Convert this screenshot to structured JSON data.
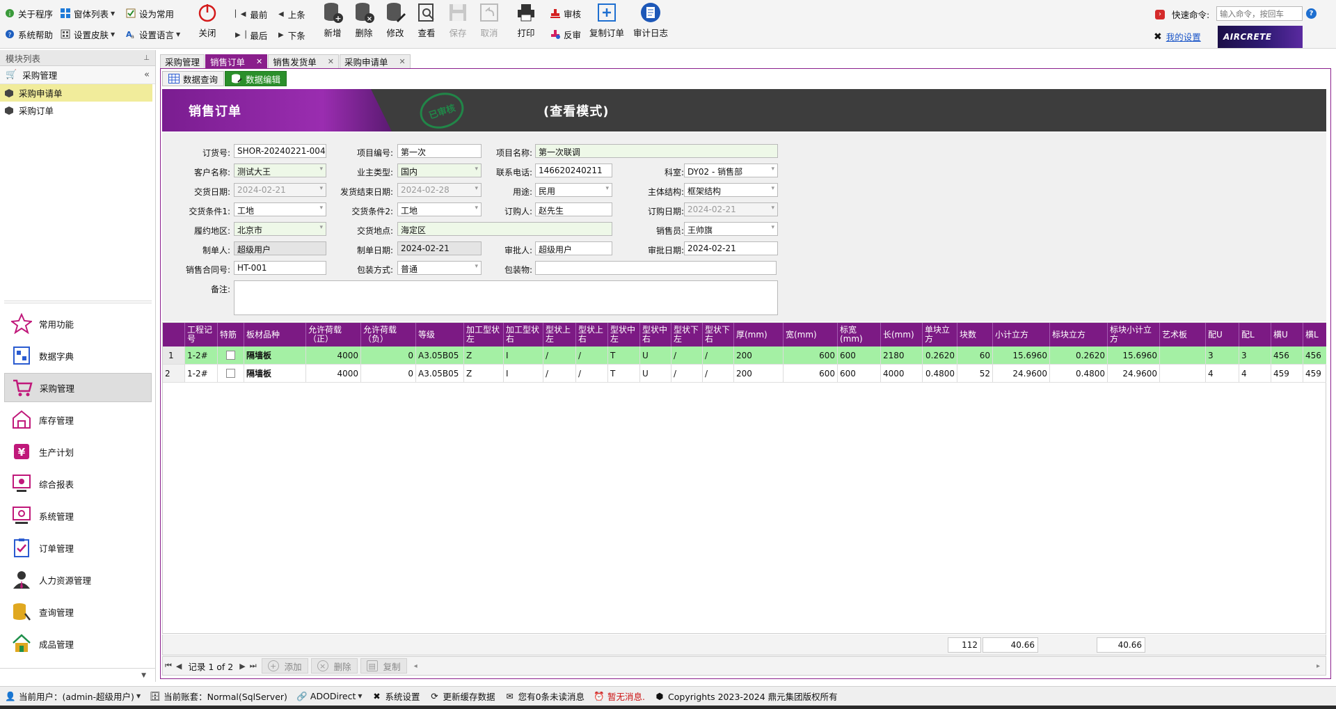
{
  "ribbon": {
    "small_left": {
      "about": "关于程序",
      "help": "系统帮助",
      "window_list": "窗体列表",
      "skin": "设置皮肤",
      "set_common": "设为常用",
      "language": "设置语言"
    },
    "close": "关闭",
    "nav": {
      "first": "最前",
      "prev": "上条",
      "last": "最后",
      "next": "下条"
    },
    "buttons": {
      "add": "新增",
      "delete": "删除",
      "modify": "修改",
      "view": "查看",
      "save": "保存",
      "cancel": "取消",
      "print": "打印",
      "audit": "审核",
      "unaudit": "反审",
      "copy_order": "复制订单",
      "audit_log": "审计日志"
    },
    "quick_command_label": "快速命令:",
    "quick_command_placeholder": "输入命令，按回车",
    "my_settings": "我的设置",
    "logo_text": "AIRCRETE"
  },
  "left_panel": {
    "header": "模块列表",
    "group_title": "采购管理",
    "tree_items": [
      "采购申请单",
      "采购订单"
    ],
    "nav_items": [
      "常用功能",
      "数据字典",
      "采购管理",
      "库存管理",
      "生产计划",
      "综合报表",
      "系统管理",
      "订单管理",
      "人力资源管理",
      "查询管理",
      "成品管理"
    ]
  },
  "doc_tabs": [
    "采购管理",
    "销售订单",
    "销售发货单",
    "采购申请单"
  ],
  "sub_tabs": [
    "数据查询",
    "数据编辑"
  ],
  "banner": {
    "title": "销售订单",
    "stamp": "已审核",
    "mode": "(查看模式)"
  },
  "form": {
    "order_no_label": "订货号:",
    "order_no": "SHOR-20240221-004",
    "project_no_label": "项目编号:",
    "project_no": "第一次",
    "project_name_label": "项目名称:",
    "project_name": "第一次联调",
    "customer_label": "客户名称:",
    "customer": "测试大王",
    "owner_type_label": "业主类型:",
    "owner_type": "国内",
    "phone_label": "联系电话:",
    "phone": "146620240211",
    "dept_label": "科室:",
    "dept": "DY02 - 销售部",
    "delivery_date_label": "交货日期:",
    "delivery_date": "2024-02-21",
    "delivery_end_label": "发货结束日期:",
    "delivery_end": "2024-02-28",
    "usage_label": "用途:",
    "usage": "民用",
    "structure_label": "主体结构:",
    "structure": "框架结构",
    "cond1_label": "交货条件1:",
    "cond1": "工地",
    "cond2_label": "交货条件2:",
    "cond2": "工地",
    "orderer_label": "订购人:",
    "orderer": "赵先生",
    "order_date_label": "订购日期:",
    "order_date": "2024-02-21",
    "region_label": "履约地区:",
    "region": "北京市",
    "place_label": "交货地点:",
    "place": "海定区",
    "salesman_label": "销售员:",
    "salesman": "王帅旗",
    "maker_label": "制单人:",
    "maker": "超级用户",
    "make_date_label": "制单日期:",
    "make_date": "2024-02-21",
    "approver_label": "审批人:",
    "approver": "超级用户",
    "approve_date_label": "审批日期:",
    "approve_date": "2024-02-21",
    "contract_label": "销售合同号:",
    "contract": "HT-001",
    "packing_label": "包装方式:",
    "packing": "普通",
    "package_label": "包装物:",
    "package": "",
    "remark_label": "备注:",
    "remark": ""
  },
  "grid": {
    "headers": [
      "工程记号",
      "特筋",
      "板材品种",
      "允许荷载（正）",
      "允许荷载（负）",
      "等级",
      "加工型状左",
      "加工型状右",
      "型状上左",
      "型状上右",
      "型状中左",
      "型状中右",
      "型状下左",
      "型状下右",
      "厚(mm)",
      "宽(mm)",
      "标宽(mm)",
      "长(mm)",
      "单块立方",
      "块数",
      "小计立方",
      "标块立方",
      "标块小计立方",
      "艺术板",
      "配U",
      "配L",
      "横U",
      "横L"
    ],
    "rows": [
      [
        "1",
        "1-2#",
        "",
        "隔墙板",
        "4000",
        "0",
        "A3.05B05",
        "Z",
        "I",
        "/",
        "/",
        "T",
        "U",
        "/",
        "/",
        "200",
        "600",
        "600",
        "2180",
        "0.2620",
        "60",
        "15.6960",
        "0.2620",
        "15.6960",
        "",
        "3",
        "3",
        "456",
        "456"
      ],
      [
        "2",
        "1-2#",
        "",
        "隔墙板",
        "4000",
        "0",
        "A3.05B05",
        "Z",
        "I",
        "/",
        "/",
        "T",
        "U",
        "/",
        "/",
        "200",
        "600",
        "600",
        "4000",
        "0.4800",
        "52",
        "24.9600",
        "0.4800",
        "24.9600",
        "",
        "4",
        "4",
        "459",
        "459"
      ]
    ],
    "summary": {
      "blocks": "112",
      "subtotal": "40.66",
      "std_subtotal": "40.66"
    }
  },
  "pager": {
    "text": "记录 1 of 2",
    "add": "添加",
    "delete": "删除",
    "copy": "复制"
  },
  "status": {
    "user": "当前用户：(admin-超级用户)",
    "account": "当前账套：Normal(SqlServer)",
    "ado": "ADODirect",
    "settings": "系统设置",
    "refresh": "更新缓存数据",
    "unread": "您有0条未读消息",
    "no_msg": "暂无消息.",
    "copyright": "Copyrights 2023-2024 鼎元集团版权所有"
  }
}
